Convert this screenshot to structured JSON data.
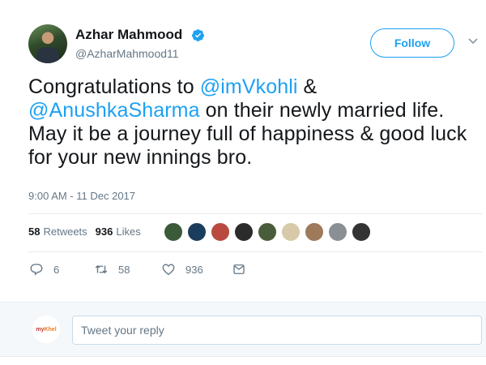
{
  "author": {
    "name": "Azhar Mahmood",
    "handle": "@AzharMahmood11",
    "verified": true
  },
  "follow_label": "Follow",
  "tweet": {
    "text_1": "Congratulations to ",
    "mention_1": "@imVkohli",
    "text_2": " &",
    "mention_2": "@AnushkaSharma",
    "text_3": " on their newly married life. May it be a journey full of happiness & good luck for your new innings bro."
  },
  "timestamp": "9:00 AM - 11 Dec 2017",
  "stats": {
    "retweets_count": "58",
    "retweets_label": "Retweets",
    "likes_count": "936",
    "likes_label": "Likes"
  },
  "liker_colors": [
    "#3a5a3a",
    "#1b3d5c",
    "#b94a3f",
    "#2b2b2b",
    "#4a5d3a",
    "#d8c9a8",
    "#9c7a5a",
    "#8a8f96",
    "#333333"
  ],
  "actions": {
    "reply_count": "6",
    "retweet_count": "58",
    "like_count": "936"
  },
  "reply": {
    "placeholder": "Tweet your reply",
    "logo_text_1": "my",
    "logo_text_2": "Khel"
  },
  "colors": {
    "accent": "#1da1f2",
    "muted": "#657786"
  }
}
